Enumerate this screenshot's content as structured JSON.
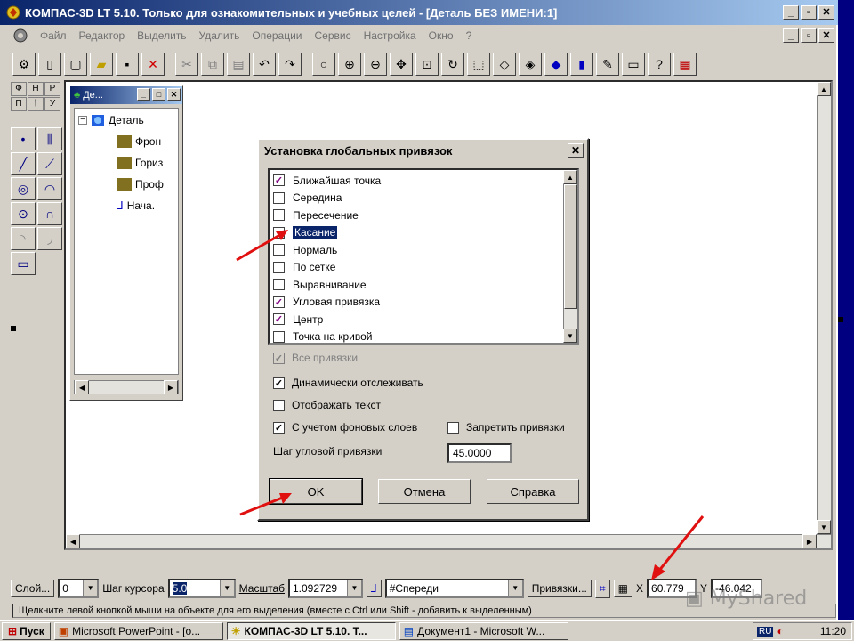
{
  "window": {
    "title": "КОМПАС-3D LT 5.10. Только для ознакомительных и учебных целей - [Деталь БЕЗ ИМЕНИ:1]"
  },
  "menu": [
    "Файл",
    "Редактор",
    "Выделить",
    "Удалить",
    "Операции",
    "Сервис",
    "Настройка",
    "Окно",
    "?"
  ],
  "tree": {
    "title": "Де...",
    "root": "Деталь",
    "nodes": [
      "Фрон",
      "Гориз",
      "Проф",
      "Нача."
    ]
  },
  "palette_tabs": [
    "Ф",
    "Н",
    "Р",
    "П",
    "†",
    "У"
  ],
  "dialog": {
    "title": "Установка глобальных привязок",
    "snaps": [
      {
        "label": "Ближайшая точка",
        "checked": true,
        "selected": false
      },
      {
        "label": "Середина",
        "checked": false,
        "selected": false
      },
      {
        "label": "Пересечение",
        "checked": false,
        "selected": false
      },
      {
        "label": "Касание",
        "checked": false,
        "selected": true
      },
      {
        "label": "Нормаль",
        "checked": false,
        "selected": false
      },
      {
        "label": "По сетке",
        "checked": false,
        "selected": false
      },
      {
        "label": "Выравнивание",
        "checked": false,
        "selected": false
      },
      {
        "label": "Угловая привязка",
        "checked": true,
        "selected": false
      },
      {
        "label": "Центр",
        "checked": true,
        "selected": false
      },
      {
        "label": "Точка на кривой",
        "checked": false,
        "selected": false
      }
    ],
    "all_snaps_label": "Все привязки",
    "dynamic_tracking_label": "Динамически отслеживать",
    "show_text_label": "Отображать текст",
    "background_layers_label": "С учетом фоновых слоев",
    "disable_snaps_label": "Запретить привязки",
    "angle_step_label": "Шаг угловой привязки",
    "angle_step_value": "45.0000",
    "ok_label": "OK",
    "cancel_label": "Отмена",
    "help_label": "Справка"
  },
  "statusbar": {
    "layer_label": "Слой...",
    "layer_value": "0",
    "cursor_step_label": "Шаг курсора",
    "cursor_step_value": "5.0",
    "scale_label": "Масштаб",
    "scale_value": "1.092729",
    "view_value": "#Спереди",
    "snaps_button": "Привязки...",
    "x_label": "X",
    "x_value": "60.779",
    "y_label": "Y",
    "y_value": "-46.042",
    "hint": "Щелкните левой кнопкой мыши на объекте для его выделения (вместе с Ctrl или Shift - добавить к выделенным)"
  },
  "taskbar": {
    "start_label": "Пуск",
    "tasks": [
      {
        "label": "Microsoft PowerPoint - [о...",
        "active": false
      },
      {
        "label": "КОМПАС-3D LT 5.10. Т...",
        "active": true
      },
      {
        "label": "Документ1 - Microsoft W...",
        "active": false
      }
    ],
    "lang": "RU",
    "clock": "11:20"
  },
  "watermark": "MyShared",
  "colors": {
    "titlebar": "#0a246a",
    "face": "#d4d0c8",
    "arrow": "#e01010",
    "check": "#800080"
  }
}
